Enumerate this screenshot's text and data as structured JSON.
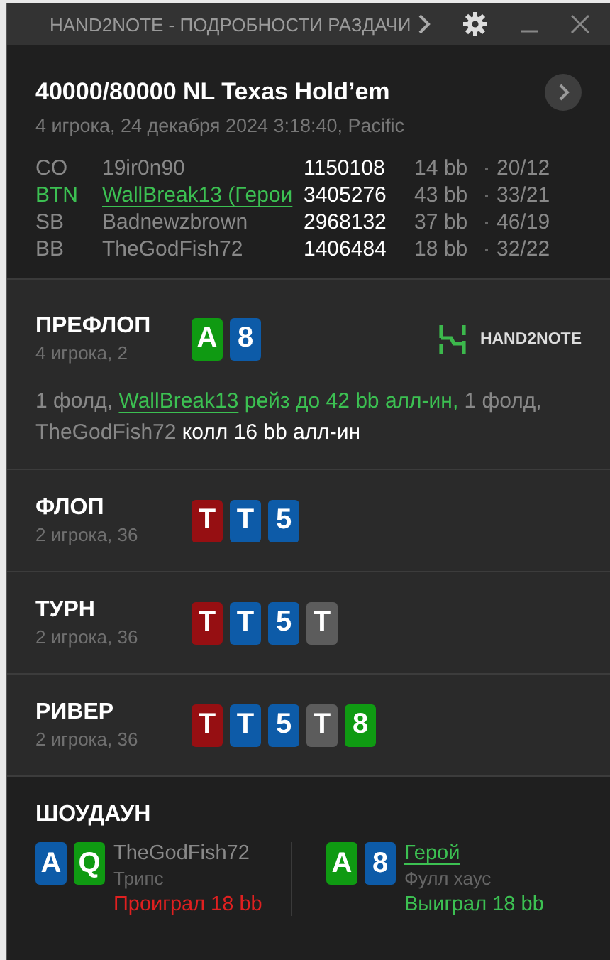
{
  "window": {
    "title": "HAND2NOTE - ПОДРОБНОСТИ РАЗДАЧИ"
  },
  "hand": {
    "title": "40000/80000 NL Texas Hold’em",
    "subtitle": "4 игрока, 24 декабря 2024 3:18:40, Pacific"
  },
  "players": [
    {
      "position": "CO",
      "name": "19ir0n90",
      "hero": false,
      "stack": "1150108",
      "bb": "14 bb",
      "stats": "20/12"
    },
    {
      "position": "BTN",
      "name": "WallBreak13 (Герои",
      "hero": true,
      "stack": "3405276",
      "bb": "43 bb",
      "stats": "33/21"
    },
    {
      "position": "SB",
      "name": "Badnewzbrown",
      "hero": false,
      "stack": "2968132",
      "bb": "37 bb",
      "stats": "46/19"
    },
    {
      "position": "BB",
      "name": "TheGodFish72",
      "hero": false,
      "stack": "1406484",
      "bb": "18 bb",
      "stats": "32/22"
    }
  ],
  "logo": {
    "text": "HAND2NOTE"
  },
  "streets": [
    {
      "name": "ПРЕФЛОП",
      "info": "4 игрока, 2",
      "cards": [
        {
          "rank": "A",
          "color": "#0f9a12"
        },
        {
          "rank": "8",
          "color": "#0d5ba8"
        }
      ],
      "actions": [
        {
          "kind": "muted",
          "text": "1 фолд, "
        },
        {
          "kind": "link",
          "text": "WallBreak13"
        },
        {
          "kind": "hero",
          "text": " рейз до 42 bb алл-ин,"
        },
        {
          "kind": "muted",
          "text": " 1 фолд, TheGodFish72"
        },
        {
          "kind": "bright",
          "text": " колл 16 bb алл-ин"
        }
      ]
    },
    {
      "name": "ФЛОП",
      "info": "2 игрока, 36",
      "cards": [
        {
          "rank": "T",
          "color": "#960f12"
        },
        {
          "rank": "T",
          "color": "#0d5ba8"
        },
        {
          "rank": "5",
          "color": "#0d5ba8"
        }
      ]
    },
    {
      "name": "ТУРН",
      "info": "2 игрока, 36",
      "cards": [
        {
          "rank": "T",
          "color": "#960f12"
        },
        {
          "rank": "T",
          "color": "#0d5ba8"
        },
        {
          "rank": "5",
          "color": "#0d5ba8"
        },
        {
          "rank": "T",
          "color": "#5c5c5c"
        }
      ]
    },
    {
      "name": "РИВЕР",
      "info": "2 игрока, 36",
      "cards": [
        {
          "rank": "T",
          "color": "#960f12"
        },
        {
          "rank": "T",
          "color": "#0d5ba8"
        },
        {
          "rank": "5",
          "color": "#0d5ba8"
        },
        {
          "rank": "T",
          "color": "#5c5c5c"
        },
        {
          "rank": "8",
          "color": "#0f9a12"
        }
      ]
    }
  ],
  "showdown": {
    "title": "ШОУДАУН",
    "hands": [
      {
        "cards": [
          {
            "rank": "A",
            "color": "#0d5ba8"
          },
          {
            "rank": "Q",
            "color": "#0f9a12"
          }
        ],
        "name": "TheGodFish72",
        "hero": false,
        "combo": "Трипс",
        "result": "Проиграл 18 bb",
        "won": false
      },
      {
        "cards": [
          {
            "rank": "A",
            "color": "#0f9a12"
          },
          {
            "rank": "8",
            "color": "#0d5ba8"
          }
        ],
        "name": "Герой",
        "hero": true,
        "combo": "Фулл хаус",
        "result": "Выиграл 18 bb",
        "won": true
      }
    ]
  }
}
